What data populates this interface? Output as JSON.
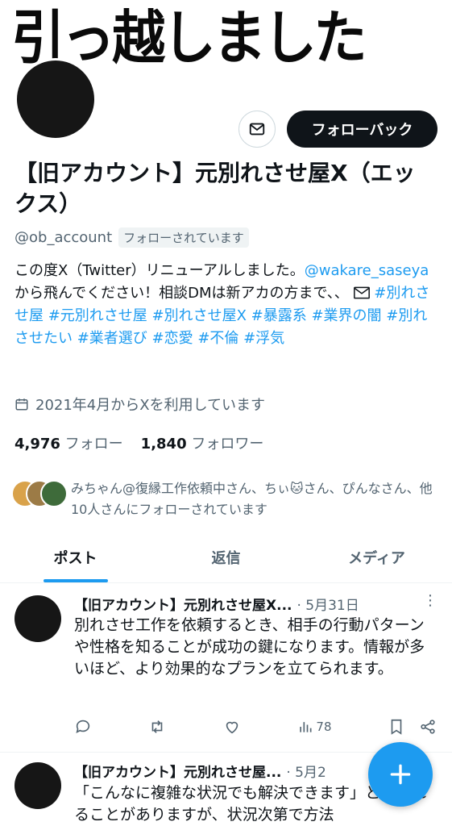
{
  "banner": {
    "text": "引っ越しました"
  },
  "profile": {
    "follow_back_label": "フォローバック",
    "name": "【旧アカウント】元別れさせ屋X（エックス）",
    "handle": "@ob_account",
    "follows_you": "フォローされています",
    "bio_parts": {
      "p1": "この度X（Twitter）リニューアルしました。",
      "p2": "@wakare_saseya",
      "p3": "から飛んでください！相談DMは新アカの方まで、、",
      "tags": "#別れさせ屋 #元別れさせ屋 #別れさせ屋X #暴露系 #業界の闇 #別れさせたい #業者選び #恋愛 #不倫 #浮気"
    },
    "joined": "2021年4月からXを利用しています",
    "following_count": "4,976",
    "following_label": "フォロー",
    "followers_count": "1,840",
    "followers_label": "フォロワー",
    "followed_by": "みちゃん@復縁工作依頼中さん、ちぃ🐱さん、ぴんなさん、他10人さんにフォローされています"
  },
  "tabs": [
    "ポスト",
    "返信",
    "メディア"
  ],
  "tweets": [
    {
      "name": "【旧アカウント】元別れさせ屋X...",
      "date": "· 5月31日",
      "body": "別れさせ工作を依頼するとき、相手の行動パターンや性格を知ることが成功の鍵になります。情報が多いほど、より効果的なプランを立てられます。",
      "views": "78"
    },
    {
      "name": "【旧アカウント】元別れさせ屋...",
      "date": "· 5月2",
      "body": "「こんなに複雑な状況でも解決できます」と聞かれることがありますが、状況次第で方法"
    }
  ],
  "colors": {
    "accent": "#1d9bf0",
    "text": "#0f1419",
    "muted": "#536471"
  }
}
